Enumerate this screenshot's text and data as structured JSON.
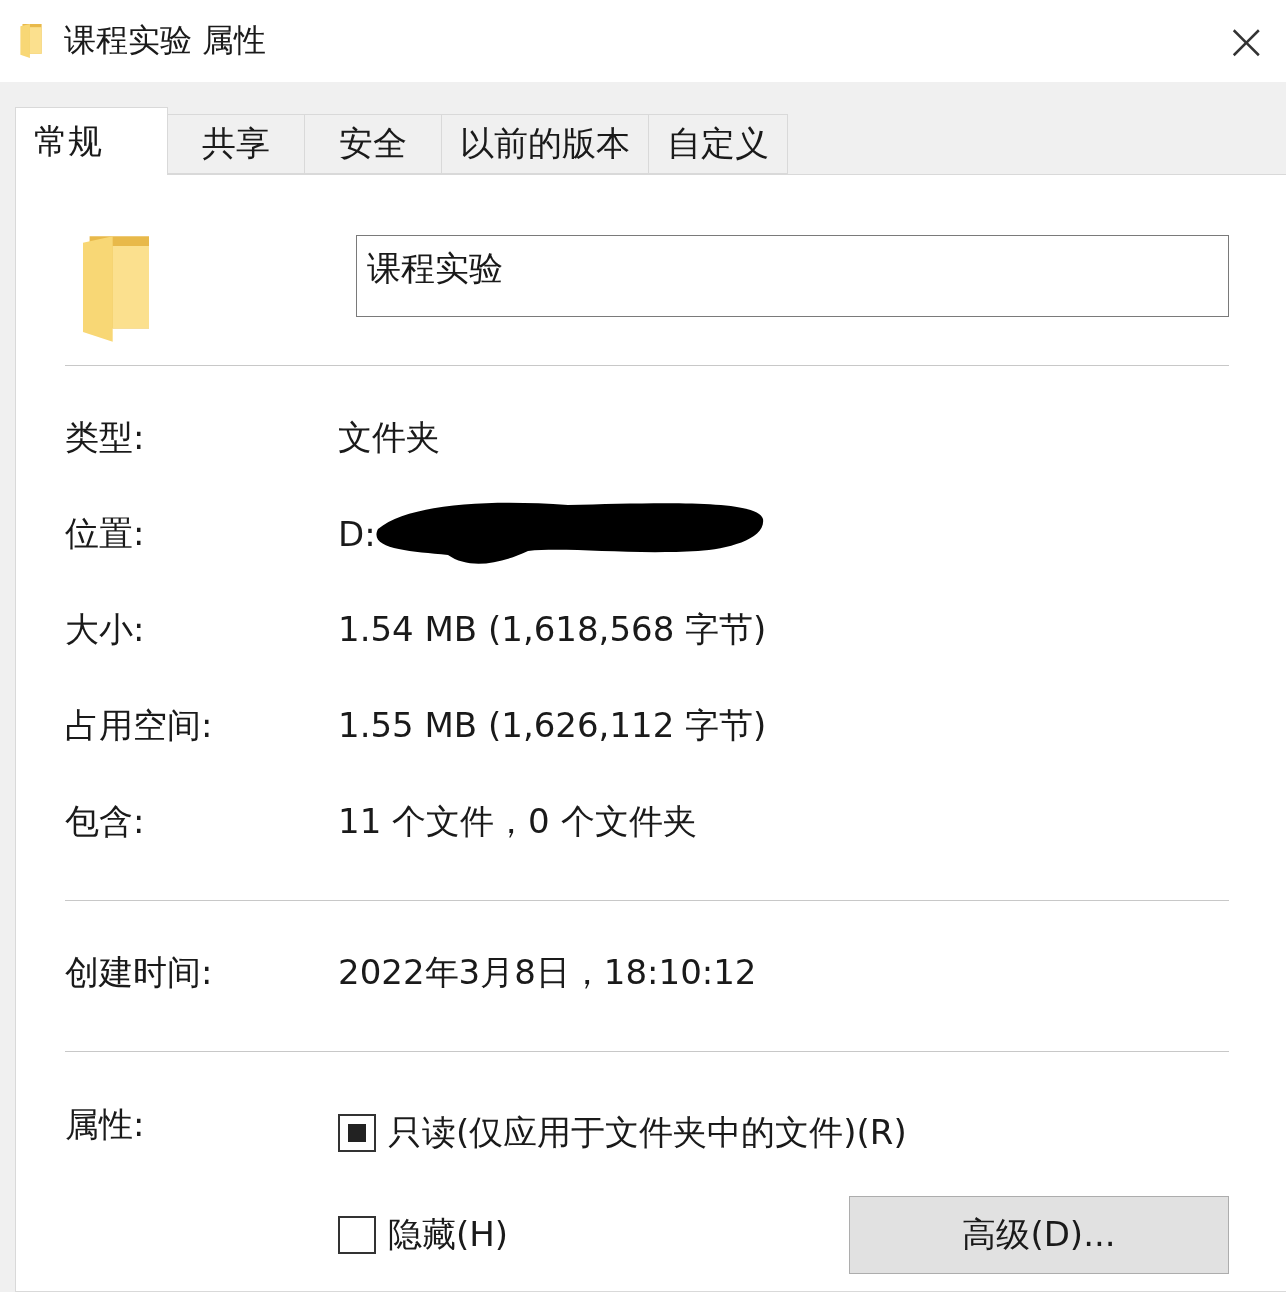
{
  "window": {
    "title": "课程实验 属性",
    "close": "×"
  },
  "tabs": [
    {
      "label": "常规",
      "selected": true
    },
    {
      "label": "共享",
      "selected": false
    },
    {
      "label": "安全",
      "selected": false
    },
    {
      "label": "以前的版本",
      "selected": false
    },
    {
      "label": "自定义",
      "selected": false
    }
  ],
  "name_field": {
    "value": "课程实验"
  },
  "groups": [
    [
      {
        "label": "类型:",
        "value": "文件夹"
      },
      {
        "label": "位置:",
        "value": "D:",
        "redacted": true
      },
      {
        "label": "大小:",
        "value": "1.54 MB (1,618,568 字节)"
      },
      {
        "label": "占用空间:",
        "value": "1.55 MB (1,626,112 字节)"
      },
      {
        "label": "包含:",
        "value": "11 个文件，0 个文件夹"
      }
    ],
    [
      {
        "label": "创建时间:",
        "value": "2022年3月8日，18:10:12"
      }
    ]
  ],
  "attributes": {
    "label": "属性:",
    "checkboxes": [
      {
        "label": "只读(仅应用于文件夹中的文件)(R)",
        "indeterminate": true
      },
      {
        "label": "隐藏(H)",
        "indeterminate": false
      }
    ],
    "advanced_button": "高级(D)..."
  }
}
